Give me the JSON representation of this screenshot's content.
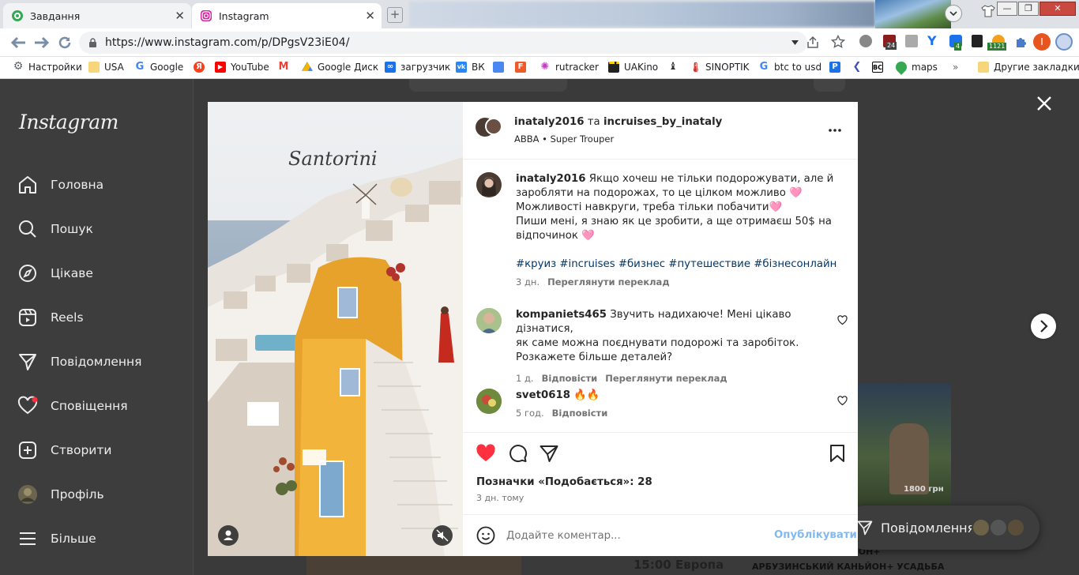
{
  "browser": {
    "tabs": [
      {
        "title": "Завдання",
        "active": false
      },
      {
        "title": "Instagram",
        "active": true
      }
    ],
    "url": "https://www.instagram.com/p/DPgsV23iE04/",
    "bookmarks": [
      {
        "label": "Настройки",
        "icon": "gear-icon"
      },
      {
        "label": "USA",
        "icon": "folder-icon"
      },
      {
        "label": "Google",
        "icon": "google-icon"
      },
      {
        "label": "Я",
        "icon": "yandex-icon"
      },
      {
        "label": "YouTube",
        "icon": "youtube-icon"
      },
      {
        "label": "M",
        "icon": "gmail-icon"
      },
      {
        "label": "Google Диск",
        "icon": "drive-icon"
      },
      {
        "label": "загрузчик",
        "icon": "infinity-icon"
      },
      {
        "label": "ВК",
        "icon": "vk-icon"
      },
      {
        "label": "rutracker",
        "icon": "rutracker-icon"
      },
      {
        "label": "UAKino",
        "icon": "film-icon"
      },
      {
        "label": "SINOPTIK",
        "icon": "thermometer-icon"
      },
      {
        "label": "btc to usd",
        "icon": "google-icon"
      },
      {
        "label": "maps",
        "icon": "maps-icon"
      },
      {
        "label": "Другие закладки",
        "icon": "folder-icon"
      }
    ],
    "extension_badges": {
      "b1": "24",
      "b2": "4",
      "b3": "1121"
    },
    "profile_initial": "I"
  },
  "sidebar": {
    "logo": "Instagram",
    "items": [
      {
        "label": "Головна",
        "icon": "home-icon"
      },
      {
        "label": "Пошук",
        "icon": "search-icon"
      },
      {
        "label": "Цікаве",
        "icon": "compass-icon"
      },
      {
        "label": "Reels",
        "icon": "reels-icon"
      },
      {
        "label": "Повідомлення",
        "icon": "direct-icon"
      },
      {
        "label": "Сповіщення",
        "icon": "heart-icon"
      },
      {
        "label": "Створити",
        "icon": "plus-square-icon"
      },
      {
        "label": "Профіль",
        "icon": "profile-avatar"
      },
      {
        "label": "Більше",
        "icon": "menu-icon"
      }
    ]
  },
  "post": {
    "media_overlay_text": "Santorini",
    "header": {
      "author": "inataly2016",
      "connector": "та",
      "coauthor": "incruises_by_inataly",
      "music": "ABBA",
      "song": "Super Trouper"
    },
    "caption": {
      "user": "inataly2016",
      "lines": [
        "Якщо хочеш не тільки подорожувати, але й",
        "заробляти на подорожах, то це цілком можливо 🩷",
        "Можливості навкруги, треба тільки побачити🩷",
        "Пиши мені, я знаю як це зробити, а ще отримаєш 50$ на",
        "відпочинок 🩷"
      ],
      "hashtags": "#круиз #incruises #бизнес #путешествие #бізнесонлайн",
      "time": "3 дн.",
      "translate": "Переглянути переклад"
    },
    "comments": [
      {
        "user": "kompaniets465",
        "lines": [
          "Звучить надихаюче! Мені цікаво дізнатися,",
          "як саме можна поєднувати подорожі та заробіток.",
          "Розкажете більше деталей?"
        ],
        "time": "1 д.",
        "reply": "Відповісти",
        "translate": "Переглянути переклад"
      },
      {
        "user": "svet0618",
        "lines": [
          "🔥🔥"
        ],
        "time": "5 год.",
        "reply": "Відповісти"
      }
    ],
    "likes": "Позначки «Подобається»: 28",
    "date": "3 дн. тому",
    "comment_placeholder": "Додайте коментар...",
    "publish": "Опублікувати"
  },
  "background": {
    "messages_pill": "Повідомлення",
    "post_text_1": "15:00 Европа",
    "post_text_2": "АКТОВСЬКИЙ КАНЬЙОН+",
    "post_text_3": "АРБУЗИНСЬКИЙ КАНЬЙОН+ УСАДЬБА",
    "price": "1800 грн"
  },
  "colors": {
    "like_red": "#ff3040",
    "link_blue": "#00376b",
    "publish_blue": "#84b9ef",
    "overlay": "#3a3a3a"
  }
}
